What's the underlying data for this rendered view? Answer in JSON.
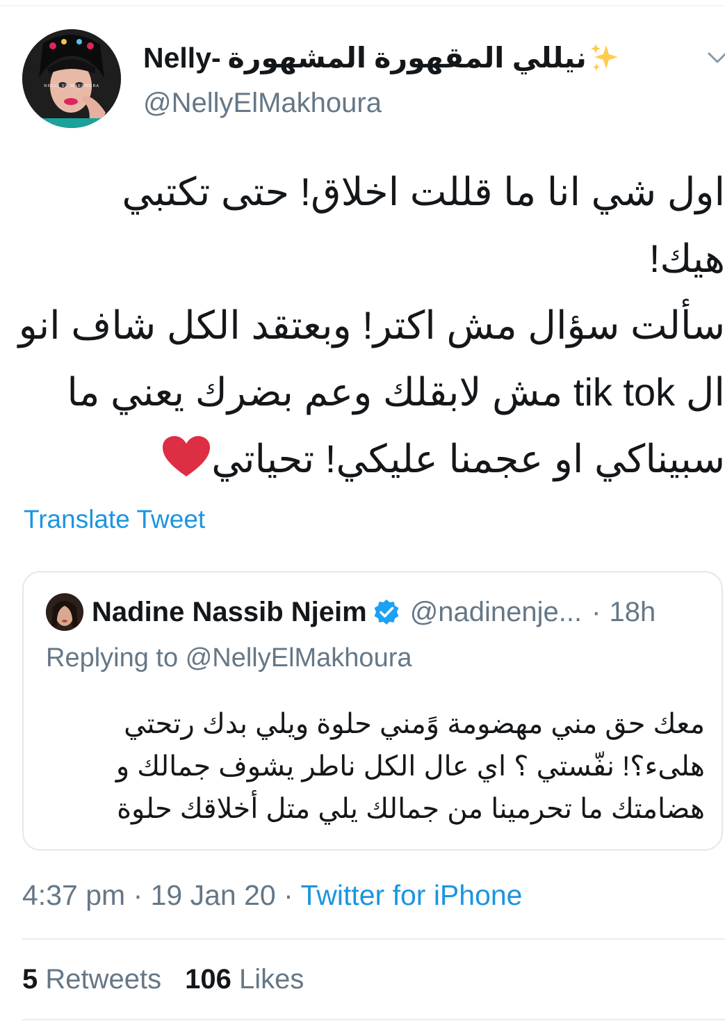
{
  "tweet": {
    "author_name_latin": "Nelly-",
    "author_name_arabic": "نيللي المقهورة المشهورة",
    "author_handle": "@NellyElMakhoura",
    "avatar_caption": "NELLY EL MAKHOURA",
    "body_lines": [
      "اول شي انا ما قللت اخلاق! حتى تكتبي",
      "هيك!",
      "سألت سؤال مش اكتر! وبعتقد الكل شاف انو",
      "ال tik tok مش لابقلك وعم بضرك يعني ما",
      "سبيناكي او عجمنا عليكي! تحياتي"
    ],
    "translate_label": "Translate Tweet",
    "time": "4:37 pm",
    "date": "19 Jan 20",
    "source": "Twitter for iPhone",
    "separator": "·",
    "retweets_count": "5",
    "retweets_label": "Retweets",
    "likes_count": "106",
    "likes_label": "Likes"
  },
  "quoted_tweet": {
    "author_name": "Nadine Nassib Njeim",
    "author_handle": "@nadinenje...",
    "time_ago": "18h",
    "replying_prefix": "Replying to",
    "replying_to": "@NellyElMakhoura",
    "body_lines": [
      "معك حق مني مهضومة وًمني حلوة ويلي بدك رتحتي",
      "هلىء؟! نفّستي ؟ اي عال الكل ناطر يشوف جمالك و",
      "هضامتك ما تحرمينا من جمالك يلي متل أخلاقك حلوة"
    ]
  },
  "colors": {
    "link": "#1b95e0",
    "secondary_text": "#657786",
    "border": "#e1e8ed",
    "heart": "#e0245e",
    "verified": "#1da1f2"
  },
  "icons": [
    "sparkles-icon",
    "chevron-down-icon",
    "heart-emoji-icon",
    "verified-badge-icon"
  ]
}
